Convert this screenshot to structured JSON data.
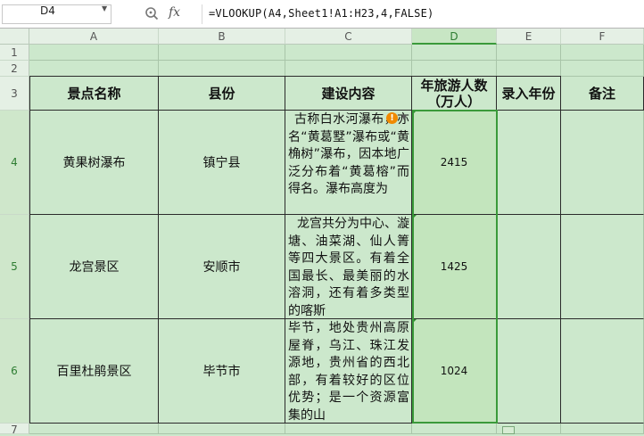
{
  "name_box": "D4",
  "formula": "=VLOOKUP(A4,Sheet1!A1:H23,4,FALSE)",
  "fx_label": "fx",
  "columns": [
    "A",
    "B",
    "C",
    "D",
    "E",
    "F"
  ],
  "rows": [
    "1",
    "2",
    "3",
    "4",
    "5",
    "6",
    "7"
  ],
  "headers": {
    "a": "景点名称",
    "b": "县份",
    "c": "建设内容",
    "d_line1": "年旅游人数",
    "d_line2": "（万人）",
    "e": "录入年份",
    "f": "备注"
  },
  "records": [
    {
      "name": "黄果树瀑布",
      "county": "镇宁县",
      "content": "古称白水河瀑布，亦名“黄葛墅”瀑布或“黄桷树”瀑布，因本地广泛分布着“黄葛榕”而得名。瀑布高度为",
      "visitors": "2415"
    },
    {
      "name": "龙宫景区",
      "county": "安顺市",
      "content": "龙宫共分为中心、漩塘、油菜湖、仙人箐等四大景区。有着全国最长、最美丽的水溶洞，还有着多类型的喀斯",
      "visitors": "1425"
    },
    {
      "name": "百里杜鹃景区",
      "county": "毕节市",
      "content": "毕节，地处贵州高原屋脊，乌江、珠江发源地，贵州省的西北部，有着较好的区位优势；是一个资源富集的山",
      "visitors": "1024"
    }
  ],
  "icons": {
    "zoom": "zoom-icon",
    "warning": "warning-icon",
    "paste_options": "paste-options-icon"
  },
  "colors": {
    "accent": "#3a9a3a",
    "cell_bg": "#cce8cc",
    "selected_bg": "#c3e5bd"
  }
}
